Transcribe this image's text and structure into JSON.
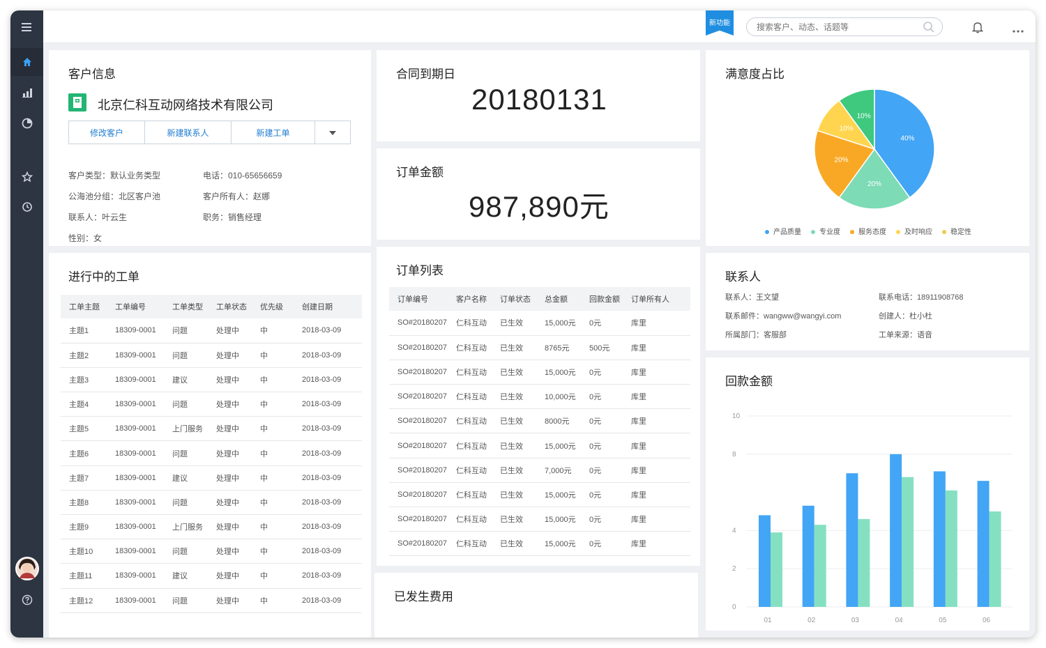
{
  "topbar": {
    "new_feature": "新功能",
    "search_placeholder": "搜索客户、动态、话题等"
  },
  "customer": {
    "title": "客户信息",
    "company": "北京仁科互动网络技术有限公司",
    "buttons": [
      "修改客户",
      "新建联系人",
      "新建工单"
    ],
    "fields": {
      "type": "客户类型：默认业务类型",
      "phone": "电话：010-65656659",
      "pool": "公海池分组：北区客户池",
      "owner": "客户所有人：赵娜",
      "contact": "联系人：叶云生",
      "position": "职务：销售经理",
      "gender": "性别：女"
    }
  },
  "contract": {
    "title": "合同到期日",
    "date": "20180131"
  },
  "order_amount": {
    "title": "订单金额",
    "value": "987,890元"
  },
  "satisfaction": {
    "title": "满意度占比",
    "legend": [
      "产品质量",
      "专业度",
      "服务态度",
      "及时响应",
      "稳定性"
    ],
    "colors": {
      "blue": "#42a5f5",
      "green": "#7ddbb6",
      "orange": "#f9a825",
      "yellow": "#ffd54f",
      "dkgreen": "#3ec97f"
    }
  },
  "workorders": {
    "title": "进行中的工单",
    "headers": [
      "工单主题",
      "工单编号",
      "工单类型",
      "工单状态",
      "优先级",
      "创建日期"
    ],
    "rows": [
      [
        "主题1",
        "18309-0001",
        "问题",
        "处理中",
        "中",
        "2018-03-09"
      ],
      [
        "主题2",
        "18309-0001",
        "问题",
        "处理中",
        "中",
        "2018-03-09"
      ],
      [
        "主题3",
        "18309-0001",
        "建议",
        "处理中",
        "中",
        "2018-03-09"
      ],
      [
        "主题4",
        "18309-0001",
        "问题",
        "处理中",
        "中",
        "2018-03-09"
      ],
      [
        "主题5",
        "18309-0001",
        "上门服务",
        "处理中",
        "中",
        "2018-03-09"
      ],
      [
        "主题6",
        "18309-0001",
        "问题",
        "处理中",
        "中",
        "2018-03-09"
      ],
      [
        "主题7",
        "18309-0001",
        "建议",
        "处理中",
        "中",
        "2018-03-09"
      ],
      [
        "主题8",
        "18309-0001",
        "问题",
        "处理中",
        "中",
        "2018-03-09"
      ],
      [
        "主题9",
        "18309-0001",
        "上门服务",
        "处理中",
        "中",
        "2018-03-09"
      ],
      [
        "主题10",
        "18309-0001",
        "问题",
        "处理中",
        "中",
        "2018-03-09"
      ],
      [
        "主题11",
        "18309-0001",
        "建议",
        "处理中",
        "中",
        "2018-03-09"
      ],
      [
        "主题12",
        "18309-0001",
        "问题",
        "处理中",
        "中",
        "2018-03-09"
      ]
    ]
  },
  "orders": {
    "title": "订单列表",
    "headers": [
      "订单编号",
      "客户名称",
      "订单状态",
      "总金额",
      "回款金额",
      "订单所有人"
    ],
    "rows": [
      [
        "SO#20180207",
        "仁科互动",
        "已生效",
        "15,000元",
        "0元",
        "库里"
      ],
      [
        "SO#20180207",
        "仁科互动",
        "已生效",
        "8765元",
        "500元",
        "库里"
      ],
      [
        "SO#20180207",
        "仁科互动",
        "已生效",
        "15,000元",
        "0元",
        "库里"
      ],
      [
        "SO#20180207",
        "仁科互动",
        "已生效",
        "10,000元",
        "0元",
        "库里"
      ],
      [
        "SO#20180207",
        "仁科互动",
        "已生效",
        "8000元",
        "0元",
        "库里"
      ],
      [
        "SO#20180207",
        "仁科互动",
        "已生效",
        "15,000元",
        "0元",
        "库里"
      ],
      [
        "SO#20180207",
        "仁科互动",
        "已生效",
        "7,000元",
        "0元",
        "库里"
      ],
      [
        "SO#20180207",
        "仁科互动",
        "已生效",
        "15,000元",
        "0元",
        "库里"
      ],
      [
        "SO#20180207",
        "仁科互动",
        "已生效",
        "15,000元",
        "0元",
        "库里"
      ],
      [
        "SO#20180207",
        "仁科互动",
        "已生效",
        "15,000元",
        "0元",
        "库里"
      ]
    ]
  },
  "contact": {
    "title": "联系人",
    "name": "联系人：王文望",
    "phone": "联系电话：18911908768",
    "email": "联系邮件：wangww@wangyi.com",
    "creator": "创建人：杜小杜",
    "dept": "所属部门：客服部",
    "source": "工单来源：语音"
  },
  "expenses": {
    "title": "已发生费用"
  },
  "chart_data": [
    {
      "type": "pie",
      "title": "满意度占比",
      "legend": [
        "产品质量",
        "专业度",
        "服务态度",
        "及时响应",
        "稳定性"
      ],
      "slices": [
        {
          "label": "40%",
          "value": 40,
          "color": "#42a5f5"
        },
        {
          "label": "20%",
          "value": 20,
          "color": "#7ddbb6"
        },
        {
          "label": "20%",
          "value": 20,
          "color": "#f9a825"
        },
        {
          "label": "10%",
          "value": 10,
          "color": "#ffd54f"
        },
        {
          "label": "10%",
          "value": 10,
          "color": "#3ec97f"
        }
      ]
    },
    {
      "type": "bar",
      "title": "回款金额",
      "categories": [
        "01",
        "02",
        "03",
        "04",
        "05",
        "06"
      ],
      "yticks": [
        "0",
        "2",
        "4",
        "8",
        "10"
      ],
      "ylim": [
        0,
        10
      ],
      "series": [
        {
          "color": "#42a5f5",
          "values": [
            4.8,
            5.3,
            7.0,
            8.0,
            7.1,
            6.6
          ]
        },
        {
          "color": "#85e0c2",
          "values": [
            3.9,
            4.3,
            4.6,
            6.8,
            6.1,
            5.0
          ]
        }
      ]
    }
  ]
}
